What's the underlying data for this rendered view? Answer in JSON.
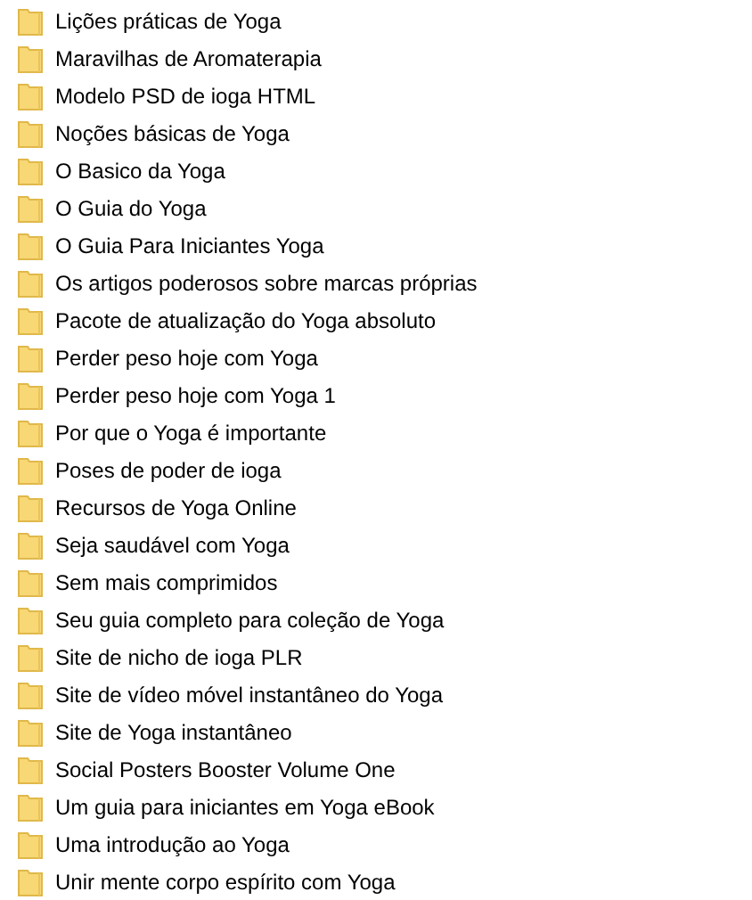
{
  "folders": [
    {
      "name": "Lições práticas de Yoga"
    },
    {
      "name": "Maravilhas de Aromaterapia"
    },
    {
      "name": "Modelo PSD de ioga HTML"
    },
    {
      "name": "Noções básicas de Yoga"
    },
    {
      "name": "O Basico da Yoga"
    },
    {
      "name": "O Guia do Yoga"
    },
    {
      "name": "O Guia Para Iniciantes Yoga"
    },
    {
      "name": "Os artigos poderosos sobre marcas próprias"
    },
    {
      "name": "Pacote de atualização do Yoga absoluto"
    },
    {
      "name": "Perder peso hoje com Yoga"
    },
    {
      "name": "Perder peso hoje com Yoga 1"
    },
    {
      "name": "Por que o Yoga é importante"
    },
    {
      "name": "Poses de poder de ioga"
    },
    {
      "name": "Recursos de Yoga Online"
    },
    {
      "name": "Seja saudável com Yoga"
    },
    {
      "name": "Sem mais comprimidos"
    },
    {
      "name": "Seu guia completo para coleção de Yoga"
    },
    {
      "name": "Site de nicho de ioga PLR"
    },
    {
      "name": "Site de vídeo móvel instantâneo do Yoga"
    },
    {
      "name": "Site de Yoga instantâneo"
    },
    {
      "name": "Social Posters Booster Volume One"
    },
    {
      "name": "Um guia para iniciantes em Yoga eBook"
    },
    {
      "name": "Uma introdução ao Yoga"
    },
    {
      "name": "Unir mente corpo espírito com Yoga"
    }
  ]
}
